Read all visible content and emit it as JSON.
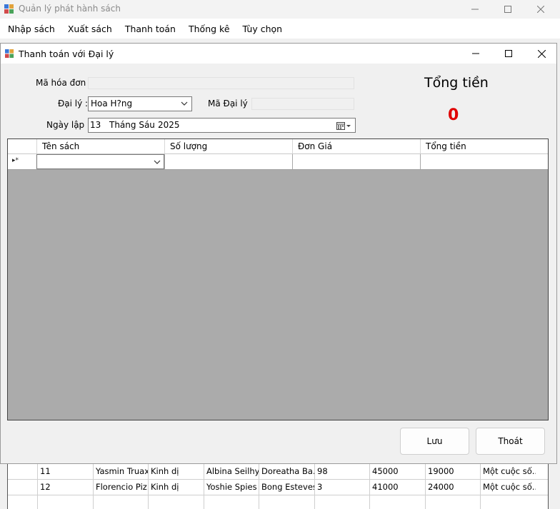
{
  "parent_window": {
    "title": "Quản lý phát hành sách",
    "menu": [
      "Nhập sách",
      "Xuất sách",
      "Thanh toán",
      "Thống kê",
      "Tùy chọn"
    ]
  },
  "child_window": {
    "title": "Thanh toán với Đại lý"
  },
  "form": {
    "invoice_label": "Mã hóa đơn :",
    "invoice_value": "",
    "agency_label": "Đại lý :",
    "agency_value": "Hoa H?ng",
    "agency_code_label": "Mã Đại lý :",
    "agency_code_value": "",
    "date_label": "Ngày lập :",
    "date_day": "13",
    "date_month": "Tháng Sáu",
    "date_year": "2025"
  },
  "total": {
    "title": "Tổng tiền",
    "value": "0"
  },
  "grid": {
    "columns": [
      "Tên sách",
      "Số lượng",
      "Đơn Giá",
      "Tổng tiền"
    ],
    "new_row_marker": "▸*"
  },
  "buttons": {
    "save": "Lưu",
    "exit": "Thoát"
  },
  "background_table": {
    "rows": [
      [
        "11",
        "Yasmin Truax",
        "Kinh dị",
        "Albina Seilhy...",
        "Doreatha Ba...",
        "98",
        "45000",
        "19000",
        "Một cuộc số..."
      ],
      [
        "12",
        "Florencio Piz...",
        "Kinh dị",
        "Yoshie Spies",
        "Bong Esteves",
        "3",
        "41000",
        "24000",
        "Một cuộc số..."
      ]
    ]
  },
  "colors": {
    "total_value": "#e00000",
    "grid_background": "#ababab"
  }
}
